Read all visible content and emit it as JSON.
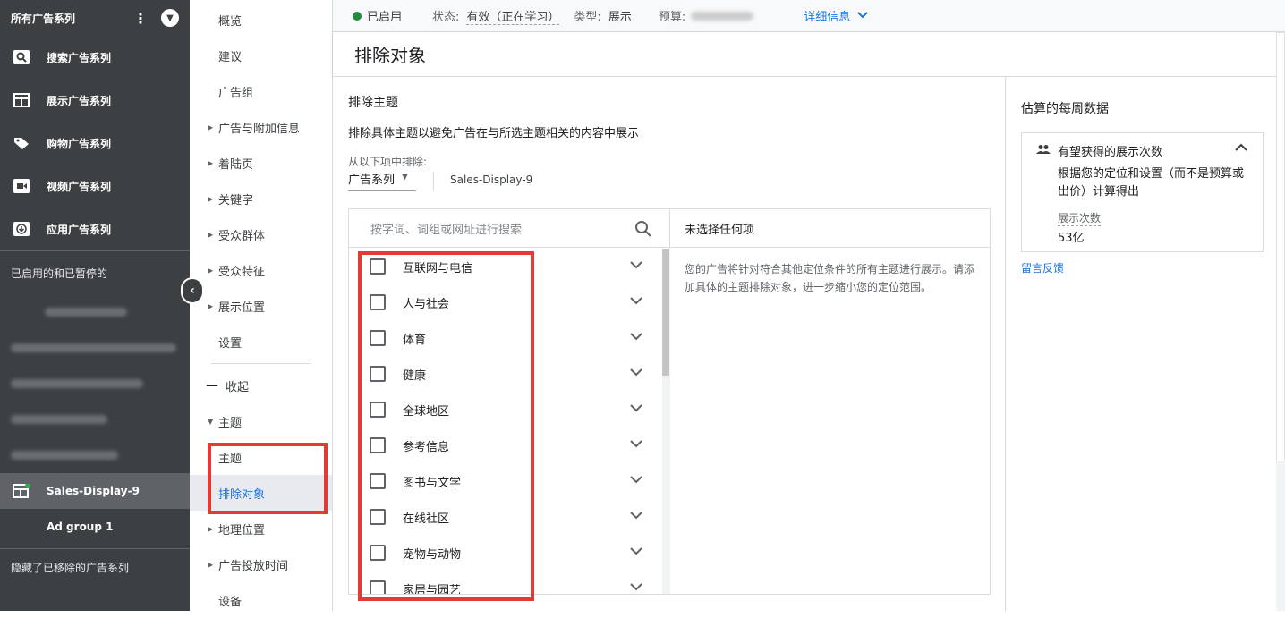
{
  "sidebar": {
    "title": "所有广告系列",
    "items": [
      {
        "icon": "search-icon",
        "label": "搜索广告系列"
      },
      {
        "icon": "display-icon",
        "label": "展示广告系列"
      },
      {
        "icon": "tag-icon",
        "label": "购物广告系列"
      },
      {
        "icon": "video-icon",
        "label": "视频广告系列"
      },
      {
        "icon": "download-icon",
        "label": "应用广告系列"
      }
    ],
    "section_label": "已启用的和已暂停的",
    "active_campaign": "Sales-Display-9",
    "ad_group": "Ad group 1",
    "hidden_label": "隐藏了已移除的广告系列"
  },
  "nav": {
    "items": [
      {
        "label": "概览",
        "arrow": false
      },
      {
        "label": "建议",
        "arrow": false
      },
      {
        "label": "广告组",
        "arrow": false
      },
      {
        "label": "广告与附加信息",
        "arrow": true
      },
      {
        "label": "着陆页",
        "arrow": true
      },
      {
        "label": "关键字",
        "arrow": true
      },
      {
        "label": "受众群体",
        "arrow": true
      },
      {
        "label": "受众特征",
        "arrow": true
      },
      {
        "label": "展示位置",
        "arrow": true
      },
      {
        "label": "设置",
        "arrow": false
      }
    ],
    "collapse": "收起",
    "topics": "主题",
    "sub_topics": "主题",
    "exclusions": "排除对象",
    "after": [
      {
        "label": "地理位置",
        "arrow": true
      },
      {
        "label": "广告投放时间",
        "arrow": true
      },
      {
        "label": "设备",
        "arrow": false
      }
    ]
  },
  "topbar": {
    "enabled": "已启用",
    "status_label": "状态:",
    "status_value": "有效（正在学习）",
    "type_label": "类型:",
    "type_value": "展示",
    "budget_label": "预算:",
    "details_link": "详细信息"
  },
  "page_title": "排除对象",
  "main": {
    "section_title": "排除主题",
    "description": "排除具体主题以避免广告在与所选主题相关的内容中展示",
    "from_label": "从以下项中排除:",
    "dropdown_value": "广告系列",
    "campaign": "Sales-Display-9",
    "search_placeholder": "按字词、词组或网址进行搜索",
    "topics": [
      "互联网与电信",
      "人与社会",
      "体育",
      "健康",
      "全球地区",
      "参考信息",
      "图书与文学",
      "在线社区",
      "宠物与动物",
      "家居与园艺"
    ],
    "right_title": "未选择任何项",
    "right_text": "您的广告将针对符合其他定位条件的所有主题进行展示。请添加具体的主题排除对象，进一步缩小您的定位范围。"
  },
  "estimate": {
    "title": "估算的每周数据",
    "card_title": "有望获得的展示次数",
    "card_desc": "根据您的定位和设置（而不是预算或出价）计算得出",
    "metric_label": "展示次数",
    "metric_value": "53亿",
    "feedback": "留言反馈"
  }
}
